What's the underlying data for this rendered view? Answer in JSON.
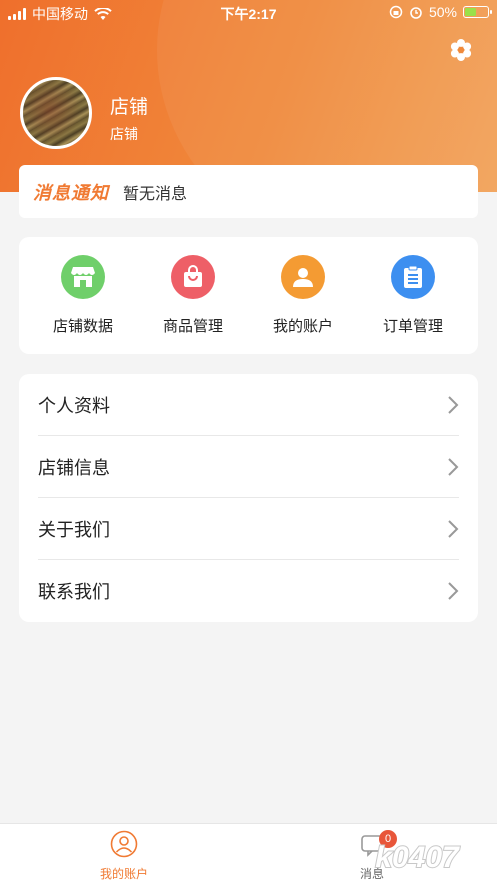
{
  "status_bar": {
    "carrier": "中国移动",
    "time": "下午2:17",
    "battery_percent": "50%",
    "battery_level": 0.5
  },
  "profile": {
    "name": "店铺",
    "subtitle": "店铺",
    "settings_icon": "gear-icon"
  },
  "notice": {
    "title": "消息通知",
    "text": "暂无消息"
  },
  "quick_actions": [
    {
      "label": "店铺数据",
      "icon": "store-icon",
      "color": "#6fcf6a"
    },
    {
      "label": "商品管理",
      "icon": "shopping-bag-icon",
      "color": "#ee5f67"
    },
    {
      "label": "我的账户",
      "icon": "user-icon",
      "color": "#f49b33"
    },
    {
      "label": "订单管理",
      "icon": "clipboard-icon",
      "color": "#3d8ff0"
    }
  ],
  "menu": [
    {
      "label": "个人资料"
    },
    {
      "label": "店铺信息"
    },
    {
      "label": "关于我们"
    },
    {
      "label": "联系我们"
    }
  ],
  "tab_bar": {
    "account_label": "我的账户",
    "messages_label": "消息",
    "messages_badge": "0",
    "active_color": "#f07a33"
  },
  "watermark": "k0407"
}
